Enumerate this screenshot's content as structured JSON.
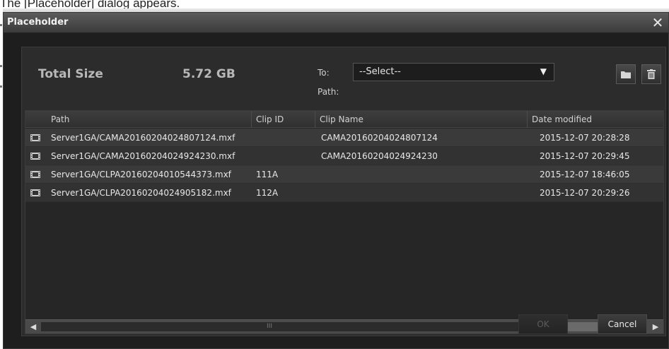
{
  "caption": "The [Placeholder] dialog appears.",
  "dialog": {
    "title": "Placeholder",
    "close_icon": "close-icon"
  },
  "summary": {
    "total_label": "Total Size",
    "total_value": "5.72 GB"
  },
  "destination": {
    "to_label": "To:",
    "path_label": "Path:",
    "select_value": "--Select--",
    "folder_icon": "folder-icon",
    "delete_icon": "trash-icon"
  },
  "table": {
    "headers": [
      "Path",
      "Clip ID",
      "Clip Name",
      "Date modified"
    ],
    "rows": [
      {
        "path": "Server1GA/CAMA20160204024807124.mxf",
        "clip_id": "",
        "clip_name": "CAMA20160204024807124",
        "date": "2015-12-07 20:28:28"
      },
      {
        "path": "Server1GA/CAMA20160204024924230.mxf",
        "clip_id": "",
        "clip_name": "CAMA20160204024924230",
        "date": "2015-12-07 20:29:45"
      },
      {
        "path": "Server1GA/CLPA20160204010544373.mxf",
        "clip_id": "111A",
        "clip_name": "",
        "date": "2015-12-07 18:46:05"
      },
      {
        "path": "Server1GA/CLPA20160204024905182.mxf",
        "clip_id": "112A",
        "clip_name": "",
        "date": "2015-12-07 20:29:26"
      }
    ]
  },
  "scrollbar": {
    "grip": "III"
  },
  "buttons": {
    "ok": "OK",
    "cancel": "Cancel"
  },
  "colors": {
    "dialog_bg": "#1e1e1e",
    "panel_bg": "#2c2c2c",
    "row_odd": "#3a3a3a",
    "row_even": "#323232"
  }
}
